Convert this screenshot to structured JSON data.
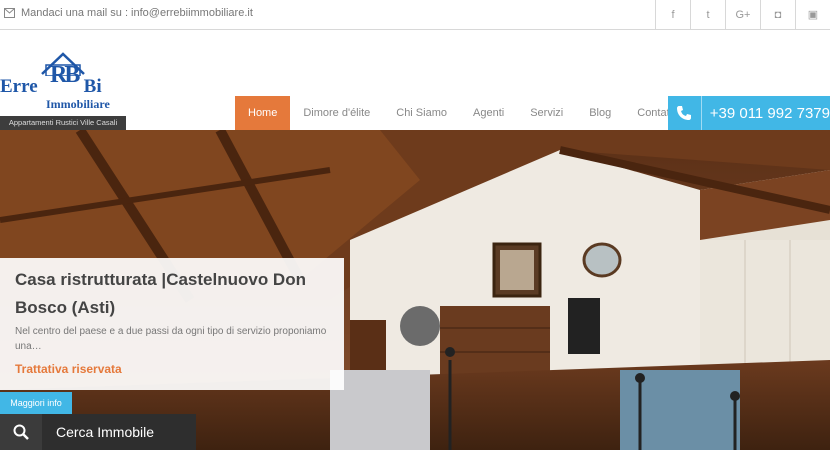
{
  "topbar": {
    "mail_text": "Mandaci una mail su : info@errebiimmobiliare.it",
    "social": [
      {
        "icon": "facebook-icon",
        "glyph": "f"
      },
      {
        "icon": "twitter-icon",
        "glyph": "t"
      },
      {
        "icon": "google-plus-icon",
        "glyph": "G+"
      },
      {
        "icon": "instagram-icon",
        "glyph": "◘"
      },
      {
        "icon": "calendar-icon",
        "glyph": "▣"
      }
    ]
  },
  "logo": {
    "name_left": "Erre",
    "monogram": "RB",
    "name_right": "Bi",
    "subtitle": "Immobiliare",
    "tagline": "Appartamenti Rustici Ville Casali"
  },
  "nav": {
    "items": [
      {
        "label": "Home",
        "active": true
      },
      {
        "label": "Dimore d'élite",
        "active": false
      },
      {
        "label": "Chi Siamo",
        "active": false
      },
      {
        "label": "Agenti",
        "active": false
      },
      {
        "label": "Servizi",
        "active": false
      },
      {
        "label": "Blog",
        "active": false
      },
      {
        "label": "Contatti",
        "active": false
      }
    ]
  },
  "phone": {
    "number": "+39 011 992 7379",
    "icon": "phone-icon"
  },
  "hero": {
    "title": "Casa ristrutturata |Castelnuovo Don Bosco (Asti)",
    "description": "Nel centro del paese e a due passi da ogni tipo di servizio proponiamo una…",
    "price": "Trattativa riservata",
    "more_label": "Maggiori info"
  },
  "search": {
    "label": "Cerca Immobile",
    "icon": "search-icon"
  },
  "colors": {
    "accent_orange": "#e5793b",
    "accent_blue": "#41b7e6",
    "logo_blue": "#1f57a8"
  }
}
